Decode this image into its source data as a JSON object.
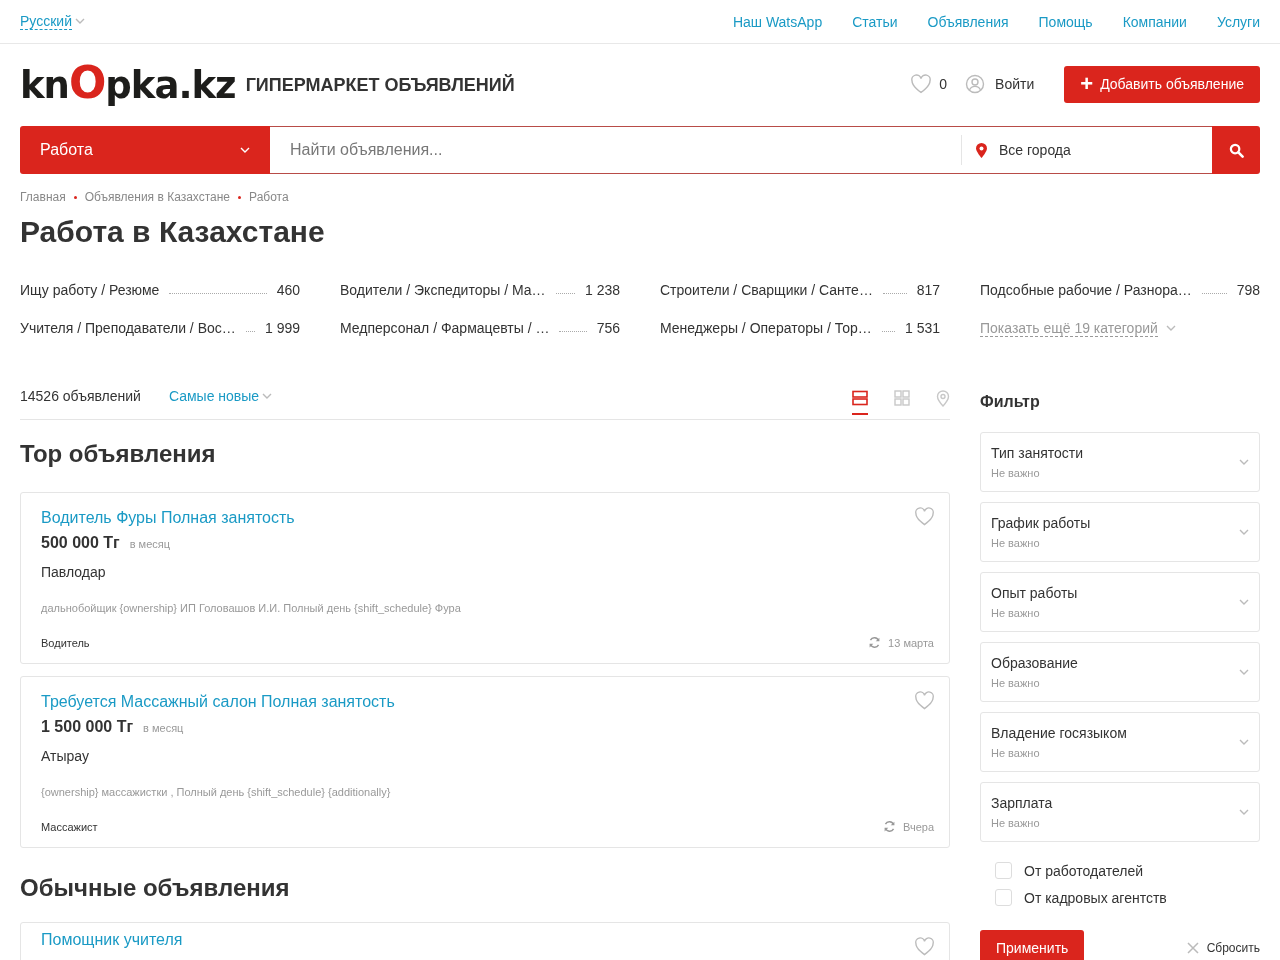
{
  "language": {
    "label": "Русский"
  },
  "top_links": [
    "Наш WatsApp",
    "Статьи",
    "Объявления",
    "Помощь",
    "Компании",
    "Услуги"
  ],
  "logo": {
    "parts": [
      {
        "text": "kn",
        "accent": false
      },
      {
        "text": "O",
        "accent": true
      },
      {
        "text": "pka.kz",
        "accent": false
      }
    ],
    "tagline": "ГИПЕРМАРКЕТ ОБЪЯВЛЕНИЙ"
  },
  "favorites": {
    "count": "0"
  },
  "login": {
    "label": "Войти"
  },
  "add_button": {
    "icon": "+",
    "label": "Добавить объявление"
  },
  "search": {
    "category": "Работа",
    "placeholder": "Найти объявления...",
    "city": "Все города"
  },
  "breadcrumbs": [
    "Главная",
    "Объявления в Казахстане",
    "Работа"
  ],
  "title": "Работа в Казахстане",
  "categories": [
    {
      "name": "Ищу работу / Резюме",
      "count": "460"
    },
    {
      "name": "Водители / Экспедиторы / Ма…",
      "count": "1 238"
    },
    {
      "name": "Строители / Сварщики / Санте…",
      "count": "817"
    },
    {
      "name": "Подсобные рабочие / Разнора…",
      "count": "798"
    },
    {
      "name": "Учителя / Преподаватели / Вос…",
      "count": "1 999"
    },
    {
      "name": "Медперсонал / Фармацевты / …",
      "count": "756"
    },
    {
      "name": "Менеджеры / Операторы / Тор…",
      "count": "1 531"
    }
  ],
  "show_more": "Показать ещё 19 категорий",
  "results": {
    "count": "14526 объявлений",
    "sort": "Самые новые",
    "views": [
      {
        "kind": "list",
        "selected": true
      },
      {
        "kind": "grid",
        "selected": false
      },
      {
        "kind": "map",
        "selected": false
      }
    ]
  },
  "top_section": {
    "title": "Top объявления",
    "listings": [
      {
        "title": "Водитель Фуры Полная занятость",
        "price": "500 000 Тг",
        "period": "в месяц",
        "city": "Павлодар",
        "description": "дальнобойщик {ownership} ИП Головашов И.И. Полный день {shift_schedule} Фура",
        "category": "Водитель",
        "date": "13 марта"
      },
      {
        "title": "Требуется Массажный салон Полная занятость",
        "price": "1 500 000 Тг",
        "period": "в месяц",
        "city": "Атырау",
        "description": "{ownership} массажистки , Полный день {shift_schedule} {additionally}",
        "category": "Массажист",
        "date": "Вчера"
      }
    ]
  },
  "regular_section": {
    "title": "Обычные объявления",
    "listings": [
      {
        "title": "Помощник учителя"
      }
    ]
  },
  "filter": {
    "title": "Фильтр",
    "groups": [
      {
        "label": "Тип занятости",
        "value": "Не важно"
      },
      {
        "label": "График работы",
        "value": "Не важно"
      },
      {
        "label": "Опыт работы",
        "value": "Не важно"
      },
      {
        "label": "Образование",
        "value": "Не важно"
      },
      {
        "label": "Владение госязыком",
        "value": "Не важно"
      },
      {
        "label": "Зарплата",
        "value": "Не важно"
      }
    ],
    "checkboxes": [
      {
        "label": "От работодателей",
        "checked": false
      },
      {
        "label": "От кадровых агентств",
        "checked": false
      }
    ],
    "apply": "Применить",
    "reset": "Сбросить"
  }
}
